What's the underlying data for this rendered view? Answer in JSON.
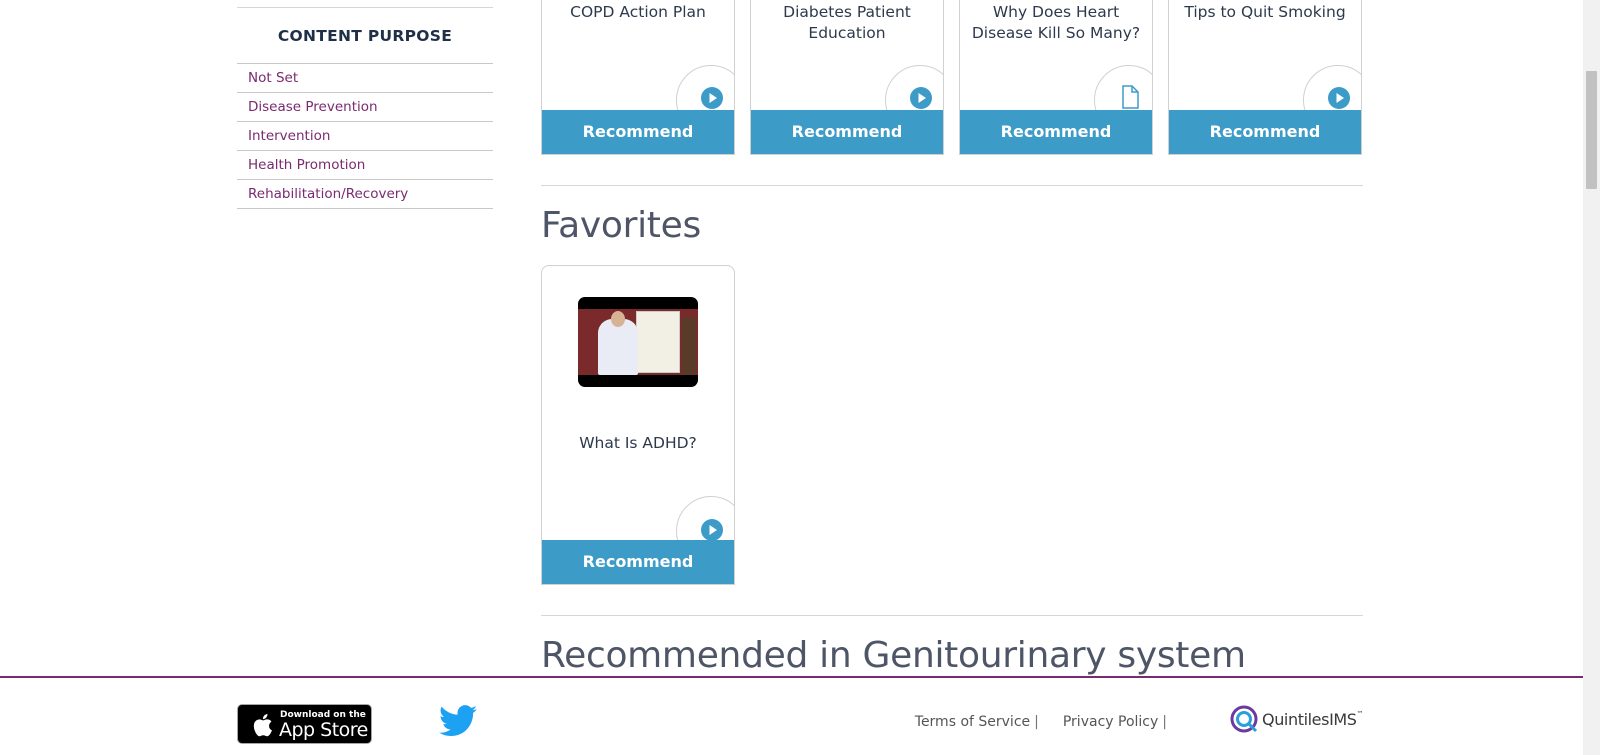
{
  "sidebar": {
    "heading": "CONTENT PURPOSE",
    "items": [
      {
        "label": "Not Set"
      },
      {
        "label": "Disease Prevention"
      },
      {
        "label": "Intervention"
      },
      {
        "label": "Health Promotion"
      },
      {
        "label": "Rehabilitation/Recovery"
      }
    ]
  },
  "top_cards": [
    {
      "title": "COPD Action Plan",
      "icon": "play-icon",
      "button": "Recommend"
    },
    {
      "title": "Diabetes Patient Education",
      "icon": "play-icon",
      "button": "Recommend"
    },
    {
      "title": "Why Does Heart Disease Kill So Many?",
      "icon": "document-icon",
      "button": "Recommend"
    },
    {
      "title": "Tips to Quit Smoking",
      "icon": "play-icon",
      "button": "Recommend"
    }
  ],
  "favorites": {
    "heading": "Favorites",
    "cards": [
      {
        "title": "What Is ADHD?",
        "icon": "play-icon",
        "button": "Recommend"
      }
    ]
  },
  "recommended": {
    "heading": "Recommended in Genitourinary system"
  },
  "footer": {
    "appstore_small": "Download on the",
    "appstore_big": "App Store",
    "terms": "Terms of Service",
    "privacy": "Privacy Policy",
    "separator": "|",
    "brand": "QuintilesIMS",
    "brand_tm": "™"
  },
  "colors": {
    "accent": "#3d9bc8",
    "link": "#7a2a6f",
    "heading": "#1f2f47"
  }
}
